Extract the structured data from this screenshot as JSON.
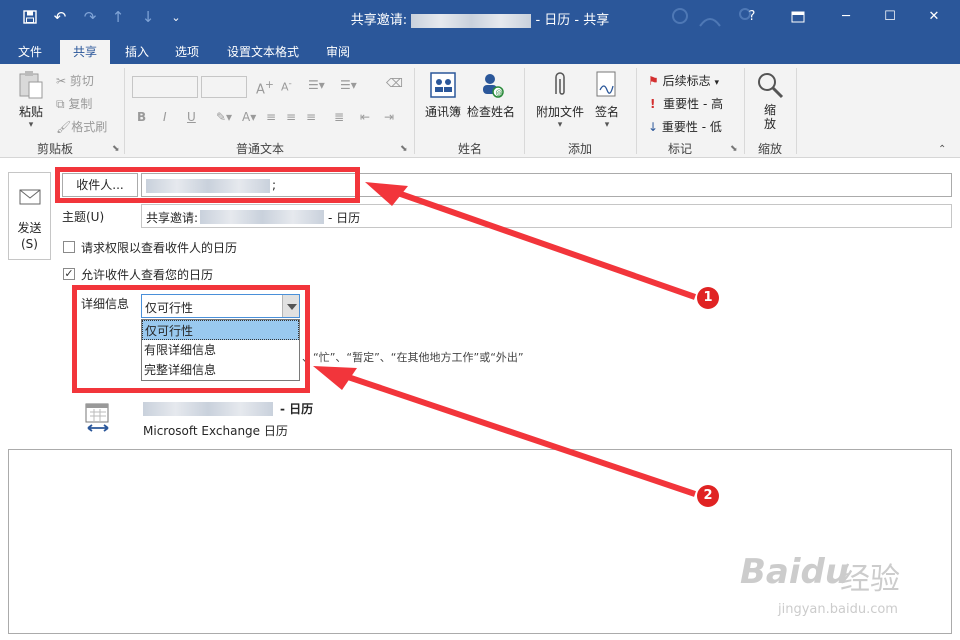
{
  "titlebar": {
    "title_prefix": "共享邀请:",
    "title_suffix": "- 日历  -  共享",
    "help": "?"
  },
  "tabs": [
    "文件",
    "共享",
    "插入",
    "选项",
    "设置文本格式",
    "审阅"
  ],
  "ribbon": {
    "clipboard": {
      "paste": "粘贴",
      "cut": "剪切",
      "copy": "复制",
      "format_painter": "格式刷",
      "group": "剪贴板"
    },
    "text": {
      "group": "普通文本"
    },
    "names": {
      "address_book": "通讯簿",
      "check_names": "检查姓名",
      "group": "姓名"
    },
    "include": {
      "attach_file": "附加文件",
      "signature": "签名",
      "group": "添加"
    },
    "tags": {
      "follow_up": "后续标志",
      "high": "重要性 - 高",
      "low": "重要性 - 低",
      "group": "标记"
    },
    "zoom": {
      "label_1": "缩",
      "label_2": "放",
      "group": "缩放"
    }
  },
  "form": {
    "send_1": "发送",
    "send_2": "(S)",
    "to_button": "收件人...",
    "to_suffix": ";",
    "subject_label": "主题(U)",
    "subject_prefix": "共享邀请:",
    "subject_suffix": "- 日历",
    "request_permission": "请求权限以查看收件人的日历",
    "allow_view": "允许收件人查看您的日历",
    "details_label": "详细信息",
    "details_selected": "仅可行性",
    "details_options": [
      "仅可行性",
      "有限详细信息",
      "完整详细信息"
    ],
    "hidden_hint": "、“忙”、“暂定”、“在其他地方工作”或“外出”",
    "calendar_suffix": "- 日历",
    "calendar_source": "Microsoft Exchange 日历"
  },
  "annotations": [
    "1",
    "2"
  ],
  "watermark": {
    "brand": "Baidu",
    "brand_cn": "经验",
    "url": "jingyan.baidu.com"
  },
  "colors": {
    "brand_blue": "#2b579a",
    "annotation_red": "#f2353b",
    "selection": "#99c9ef"
  }
}
